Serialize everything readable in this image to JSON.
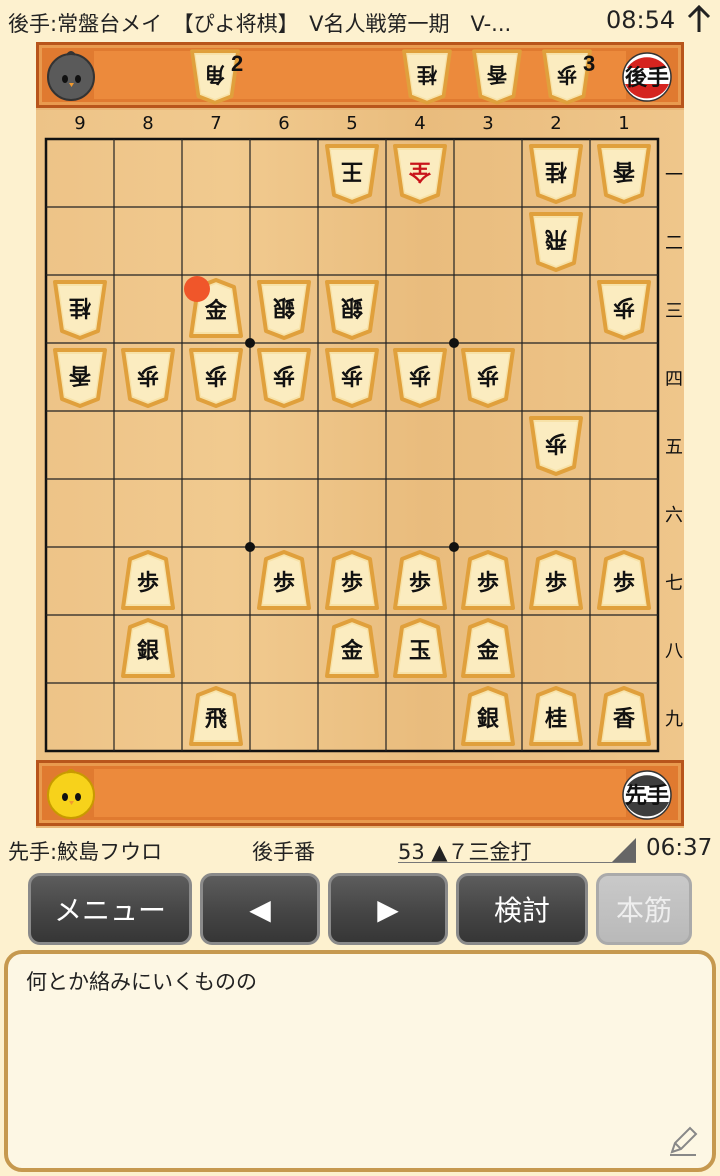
{
  "header": {
    "title": "後手:常盤台メイ　【ぴよ将棋】　V名人戦第一期　V-...",
    "clock": "08:54",
    "up_icon": "arrow-up-icon"
  },
  "gote_stand": {
    "badge": "後手",
    "avatar": "gray-chick-avatar",
    "hand": [
      {
        "label": "角",
        "count": "2"
      },
      {
        "label": "桂",
        "count": ""
      },
      {
        "label": "香",
        "count": ""
      },
      {
        "label": "歩",
        "count": "3"
      }
    ]
  },
  "sente_stand": {
    "badge": "先手",
    "avatar": "yellow-chick-avatar",
    "hand": []
  },
  "board": {
    "files": [
      "9",
      "8",
      "7",
      "6",
      "5",
      "4",
      "3",
      "2",
      "1"
    ],
    "ranks": [
      "一",
      "二",
      "三",
      "四",
      "五",
      "六",
      "七",
      "八",
      "九"
    ],
    "last_move_marker_color": "#f0562a",
    "pieces": [
      {
        "file": 5,
        "rank": 1,
        "label": "王",
        "owner": "gote"
      },
      {
        "file": 4,
        "rank": 1,
        "label": "全",
        "owner": "gote",
        "promoted": true
      },
      {
        "file": 2,
        "rank": 1,
        "label": "桂",
        "owner": "gote"
      },
      {
        "file": 1,
        "rank": 1,
        "label": "香",
        "owner": "gote"
      },
      {
        "file": 2,
        "rank": 2,
        "label": "飛",
        "owner": "gote"
      },
      {
        "file": 9,
        "rank": 3,
        "label": "桂",
        "owner": "gote"
      },
      {
        "file": 7,
        "rank": 3,
        "label": "金",
        "owner": "sente"
      },
      {
        "file": 6,
        "rank": 3,
        "label": "銀",
        "owner": "gote"
      },
      {
        "file": 5,
        "rank": 3,
        "label": "銀",
        "owner": "gote"
      },
      {
        "file": 1,
        "rank": 3,
        "label": "歩",
        "owner": "gote"
      },
      {
        "file": 9,
        "rank": 4,
        "label": "香",
        "owner": "gote"
      },
      {
        "file": 8,
        "rank": 4,
        "label": "歩",
        "owner": "gote"
      },
      {
        "file": 7,
        "rank": 4,
        "label": "歩",
        "owner": "gote"
      },
      {
        "file": 6,
        "rank": 4,
        "label": "歩",
        "owner": "gote"
      },
      {
        "file": 5,
        "rank": 4,
        "label": "歩",
        "owner": "gote"
      },
      {
        "file": 4,
        "rank": 4,
        "label": "歩",
        "owner": "gote"
      },
      {
        "file": 3,
        "rank": 4,
        "label": "歩",
        "owner": "gote"
      },
      {
        "file": 2,
        "rank": 5,
        "label": "歩",
        "owner": "gote"
      },
      {
        "file": 8,
        "rank": 7,
        "label": "歩",
        "owner": "sente"
      },
      {
        "file": 6,
        "rank": 7,
        "label": "歩",
        "owner": "sente"
      },
      {
        "file": 5,
        "rank": 7,
        "label": "歩",
        "owner": "sente"
      },
      {
        "file": 4,
        "rank": 7,
        "label": "歩",
        "owner": "sente"
      },
      {
        "file": 3,
        "rank": 7,
        "label": "歩",
        "owner": "sente"
      },
      {
        "file": 2,
        "rank": 7,
        "label": "歩",
        "owner": "sente"
      },
      {
        "file": 1,
        "rank": 7,
        "label": "歩",
        "owner": "sente"
      },
      {
        "file": 8,
        "rank": 8,
        "label": "銀",
        "owner": "sente"
      },
      {
        "file": 5,
        "rank": 8,
        "label": "金",
        "owner": "sente"
      },
      {
        "file": 4,
        "rank": 8,
        "label": "玉",
        "owner": "sente"
      },
      {
        "file": 3,
        "rank": 8,
        "label": "金",
        "owner": "sente"
      },
      {
        "file": 7,
        "rank": 9,
        "label": "飛",
        "owner": "sente"
      },
      {
        "file": 3,
        "rank": 9,
        "label": "銀",
        "owner": "sente"
      },
      {
        "file": 2,
        "rank": 9,
        "label": "桂",
        "owner": "sente"
      },
      {
        "file": 1,
        "rank": 9,
        "label": "香",
        "owner": "sente"
      }
    ],
    "last_move": {
      "file": 7,
      "rank": 3
    }
  },
  "status": {
    "sente_name": "先手:鮫島フウロ",
    "turn": "後手番",
    "move": "53 ▲７三金打",
    "time": "06:37"
  },
  "buttons": {
    "menu": "メニュー",
    "prev": "◀",
    "next": "▶",
    "analyze": "検討",
    "mainline": "本筋"
  },
  "comment": {
    "text": "何とか絡みにいくものの",
    "edit_icon": "pencil-icon"
  },
  "colors": {
    "stand": "#e07a30",
    "board": "#edc387",
    "background": "#fdf1cf",
    "button": "#454545"
  }
}
